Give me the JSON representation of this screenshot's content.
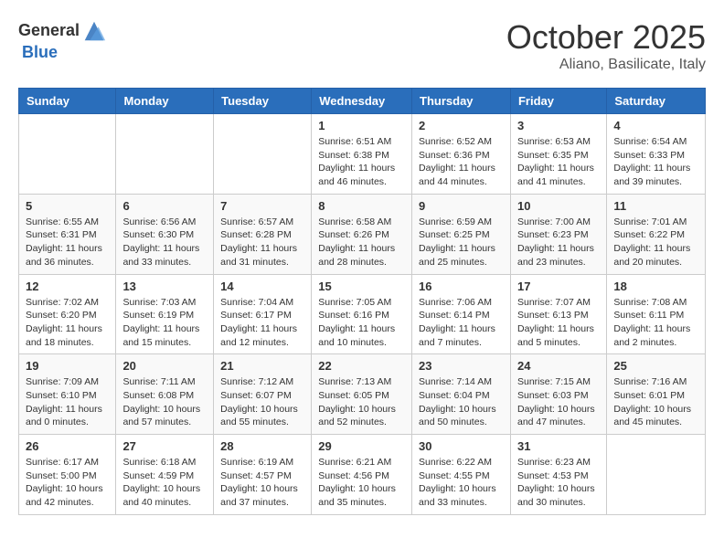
{
  "header": {
    "logo_general": "General",
    "logo_blue": "Blue",
    "month": "October 2025",
    "location": "Aliano, Basilicate, Italy"
  },
  "days_of_week": [
    "Sunday",
    "Monday",
    "Tuesday",
    "Wednesday",
    "Thursday",
    "Friday",
    "Saturday"
  ],
  "weeks": [
    [
      {
        "day": "",
        "info": ""
      },
      {
        "day": "",
        "info": ""
      },
      {
        "day": "",
        "info": ""
      },
      {
        "day": "1",
        "info": "Sunrise: 6:51 AM\nSunset: 6:38 PM\nDaylight: 11 hours and 46 minutes."
      },
      {
        "day": "2",
        "info": "Sunrise: 6:52 AM\nSunset: 6:36 PM\nDaylight: 11 hours and 44 minutes."
      },
      {
        "day": "3",
        "info": "Sunrise: 6:53 AM\nSunset: 6:35 PM\nDaylight: 11 hours and 41 minutes."
      },
      {
        "day": "4",
        "info": "Sunrise: 6:54 AM\nSunset: 6:33 PM\nDaylight: 11 hours and 39 minutes."
      }
    ],
    [
      {
        "day": "5",
        "info": "Sunrise: 6:55 AM\nSunset: 6:31 PM\nDaylight: 11 hours and 36 minutes."
      },
      {
        "day": "6",
        "info": "Sunrise: 6:56 AM\nSunset: 6:30 PM\nDaylight: 11 hours and 33 minutes."
      },
      {
        "day": "7",
        "info": "Sunrise: 6:57 AM\nSunset: 6:28 PM\nDaylight: 11 hours and 31 minutes."
      },
      {
        "day": "8",
        "info": "Sunrise: 6:58 AM\nSunset: 6:26 PM\nDaylight: 11 hours and 28 minutes."
      },
      {
        "day": "9",
        "info": "Sunrise: 6:59 AM\nSunset: 6:25 PM\nDaylight: 11 hours and 25 minutes."
      },
      {
        "day": "10",
        "info": "Sunrise: 7:00 AM\nSunset: 6:23 PM\nDaylight: 11 hours and 23 minutes."
      },
      {
        "day": "11",
        "info": "Sunrise: 7:01 AM\nSunset: 6:22 PM\nDaylight: 11 hours and 20 minutes."
      }
    ],
    [
      {
        "day": "12",
        "info": "Sunrise: 7:02 AM\nSunset: 6:20 PM\nDaylight: 11 hours and 18 minutes."
      },
      {
        "day": "13",
        "info": "Sunrise: 7:03 AM\nSunset: 6:19 PM\nDaylight: 11 hours and 15 minutes."
      },
      {
        "day": "14",
        "info": "Sunrise: 7:04 AM\nSunset: 6:17 PM\nDaylight: 11 hours and 12 minutes."
      },
      {
        "day": "15",
        "info": "Sunrise: 7:05 AM\nSunset: 6:16 PM\nDaylight: 11 hours and 10 minutes."
      },
      {
        "day": "16",
        "info": "Sunrise: 7:06 AM\nSunset: 6:14 PM\nDaylight: 11 hours and 7 minutes."
      },
      {
        "day": "17",
        "info": "Sunrise: 7:07 AM\nSunset: 6:13 PM\nDaylight: 11 hours and 5 minutes."
      },
      {
        "day": "18",
        "info": "Sunrise: 7:08 AM\nSunset: 6:11 PM\nDaylight: 11 hours and 2 minutes."
      }
    ],
    [
      {
        "day": "19",
        "info": "Sunrise: 7:09 AM\nSunset: 6:10 PM\nDaylight: 11 hours and 0 minutes."
      },
      {
        "day": "20",
        "info": "Sunrise: 7:11 AM\nSunset: 6:08 PM\nDaylight: 10 hours and 57 minutes."
      },
      {
        "day": "21",
        "info": "Sunrise: 7:12 AM\nSunset: 6:07 PM\nDaylight: 10 hours and 55 minutes."
      },
      {
        "day": "22",
        "info": "Sunrise: 7:13 AM\nSunset: 6:05 PM\nDaylight: 10 hours and 52 minutes."
      },
      {
        "day": "23",
        "info": "Sunrise: 7:14 AM\nSunset: 6:04 PM\nDaylight: 10 hours and 50 minutes."
      },
      {
        "day": "24",
        "info": "Sunrise: 7:15 AM\nSunset: 6:03 PM\nDaylight: 10 hours and 47 minutes."
      },
      {
        "day": "25",
        "info": "Sunrise: 7:16 AM\nSunset: 6:01 PM\nDaylight: 10 hours and 45 minutes."
      }
    ],
    [
      {
        "day": "26",
        "info": "Sunrise: 6:17 AM\nSunset: 5:00 PM\nDaylight: 10 hours and 42 minutes."
      },
      {
        "day": "27",
        "info": "Sunrise: 6:18 AM\nSunset: 4:59 PM\nDaylight: 10 hours and 40 minutes."
      },
      {
        "day": "28",
        "info": "Sunrise: 6:19 AM\nSunset: 4:57 PM\nDaylight: 10 hours and 37 minutes."
      },
      {
        "day": "29",
        "info": "Sunrise: 6:21 AM\nSunset: 4:56 PM\nDaylight: 10 hours and 35 minutes."
      },
      {
        "day": "30",
        "info": "Sunrise: 6:22 AM\nSunset: 4:55 PM\nDaylight: 10 hours and 33 minutes."
      },
      {
        "day": "31",
        "info": "Sunrise: 6:23 AM\nSunset: 4:53 PM\nDaylight: 10 hours and 30 minutes."
      },
      {
        "day": "",
        "info": ""
      }
    ]
  ]
}
